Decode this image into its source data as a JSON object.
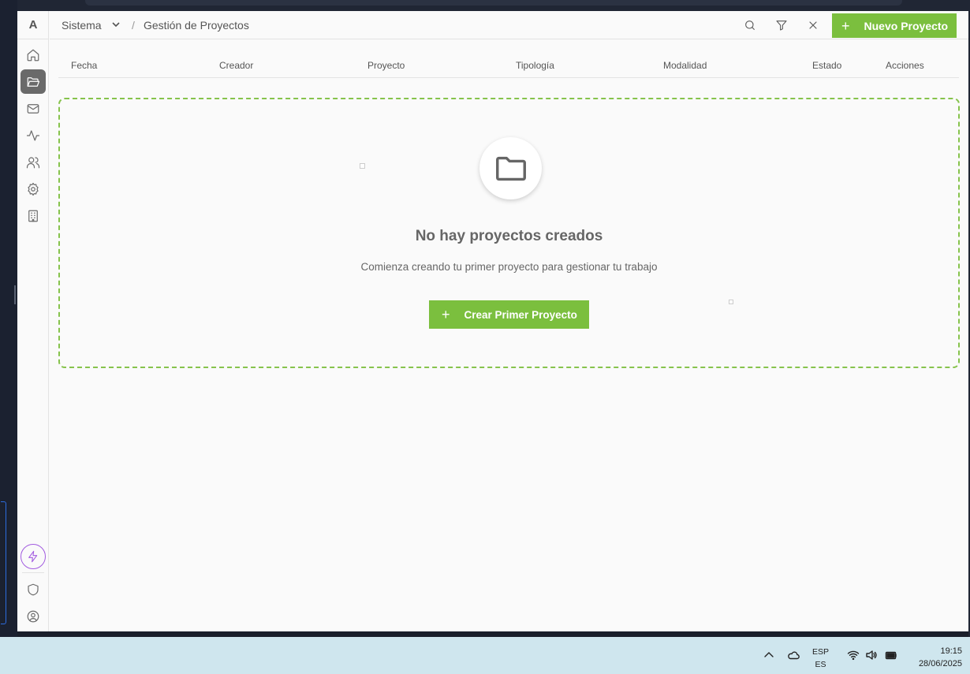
{
  "app": {
    "logo_letter": "A"
  },
  "header": {
    "breadcrumb_root": "Sistema",
    "breadcrumb_separator": "/",
    "breadcrumb_page": "Gestión de Proyectos",
    "new_button_plus": "+",
    "new_button_label": "Nuevo Proyecto"
  },
  "sidebar": {
    "items": [
      {
        "icon": "home-icon",
        "active": false
      },
      {
        "icon": "folder-open-icon",
        "active": true
      },
      {
        "icon": "mail-icon",
        "active": false
      },
      {
        "icon": "activity-icon",
        "active": false
      },
      {
        "icon": "users-icon",
        "active": false
      },
      {
        "icon": "settings-icon",
        "active": false
      },
      {
        "icon": "building-icon",
        "active": false
      }
    ],
    "bottom_items": [
      "bolt-icon",
      "shield-icon",
      "user-circle-icon"
    ]
  },
  "table": {
    "columns": [
      "Fecha",
      "Creador",
      "Proyecto",
      "Tipología",
      "Modalidad",
      "Estado",
      "Acciones"
    ]
  },
  "empty_state": {
    "icon": "folder-icon",
    "title": "No hay proyectos creados",
    "subtitle": "Comienza creando tu primer proyecto para gestionar tu trabajo",
    "button_plus": "+",
    "button_label": "Crear Primer Proyecto"
  },
  "taskbar": {
    "lang_top": "ESP",
    "lang_bottom": "ES",
    "time": "19:15",
    "date": "28/06/2025"
  },
  "colors": {
    "accent_green": "#7bbf3e",
    "dashed_border": "#86c34c",
    "bolt_purple": "#a25be0",
    "active_nav": "#6a6a6a"
  }
}
